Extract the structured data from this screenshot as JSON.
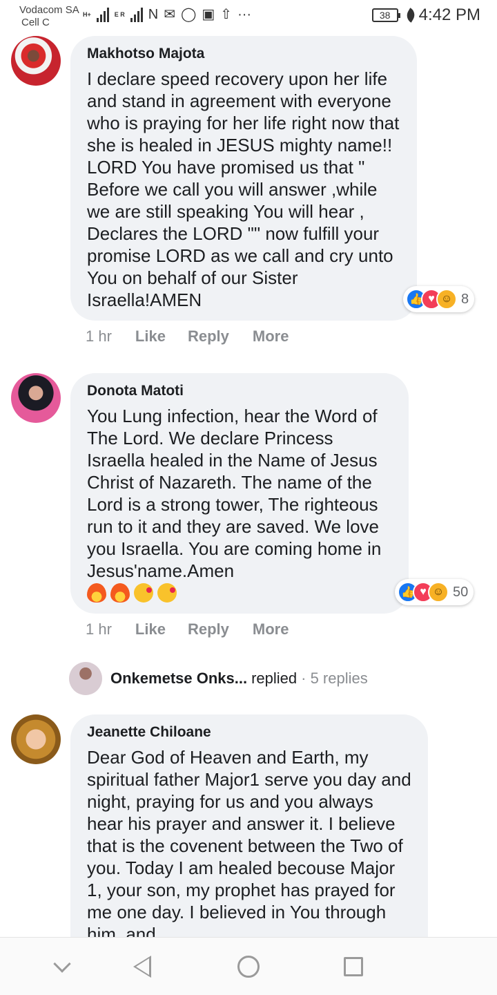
{
  "status_bar": {
    "carrier_line1": "Vodacom SA",
    "carrier_line2": "Cell C",
    "net1": "H+",
    "net2": "E R",
    "battery": "38",
    "time": "4:42 PM"
  },
  "comments": [
    {
      "author": "Makhotso Majota",
      "text": "I declare speed recovery upon her life and stand in agreement with everyone who is praying for her life right now that she is healed in JESUS mighty name!! LORD You have promised us that \" Before we call you will answer ,while we are still speaking You will hear , Declares the LORD \"\" now fulfill your promise LORD as we call and cry unto You on behalf of our Sister Israella!AMEN",
      "time": "1 hr",
      "like": "Like",
      "reply": "Reply",
      "more": "More",
      "reaction_count": "8",
      "reactions": [
        "like-icon",
        "love-icon",
        "haha-icon"
      ]
    },
    {
      "author": "Donota Matoti",
      "text": "You Lung infection, hear the Word of The Lord. We declare Princess Israella healed in the Name of Jesus Christ of Nazareth. The name of the Lord is a strong tower, The righteous run to it and they are saved. We love you Israella. You are coming home in Jesus'name.Amen",
      "emojis": [
        "fire-emoji",
        "fire-emoji",
        "kiss-emoji",
        "kiss-emoji"
      ],
      "time": "1 hr",
      "like": "Like",
      "reply": "Reply",
      "more": "More",
      "reaction_count": "50",
      "reactions": [
        "like-icon",
        "love-icon",
        "care-icon"
      ]
    },
    {
      "author": "Jeanette Chiloane",
      "text": "Dear God of Heaven and Earth, my spiritual father Major1 serve you day and night, praying for us and you always hear his prayer and answer it. I believe that is the covenent between the Two of you. Today I am healed becouse Major 1, your son, my prophet has prayed for me one day. I believed in You through him, and"
    }
  ],
  "replies_row": {
    "name": "Onkemetse Onks...",
    "word": "replied",
    "count": "· 5 replies"
  },
  "colors": {
    "bubble": "#f0f2f5",
    "meta_gray": "#8a8d91",
    "like_blue": "#1877f2",
    "love_red": "#f33e58"
  }
}
